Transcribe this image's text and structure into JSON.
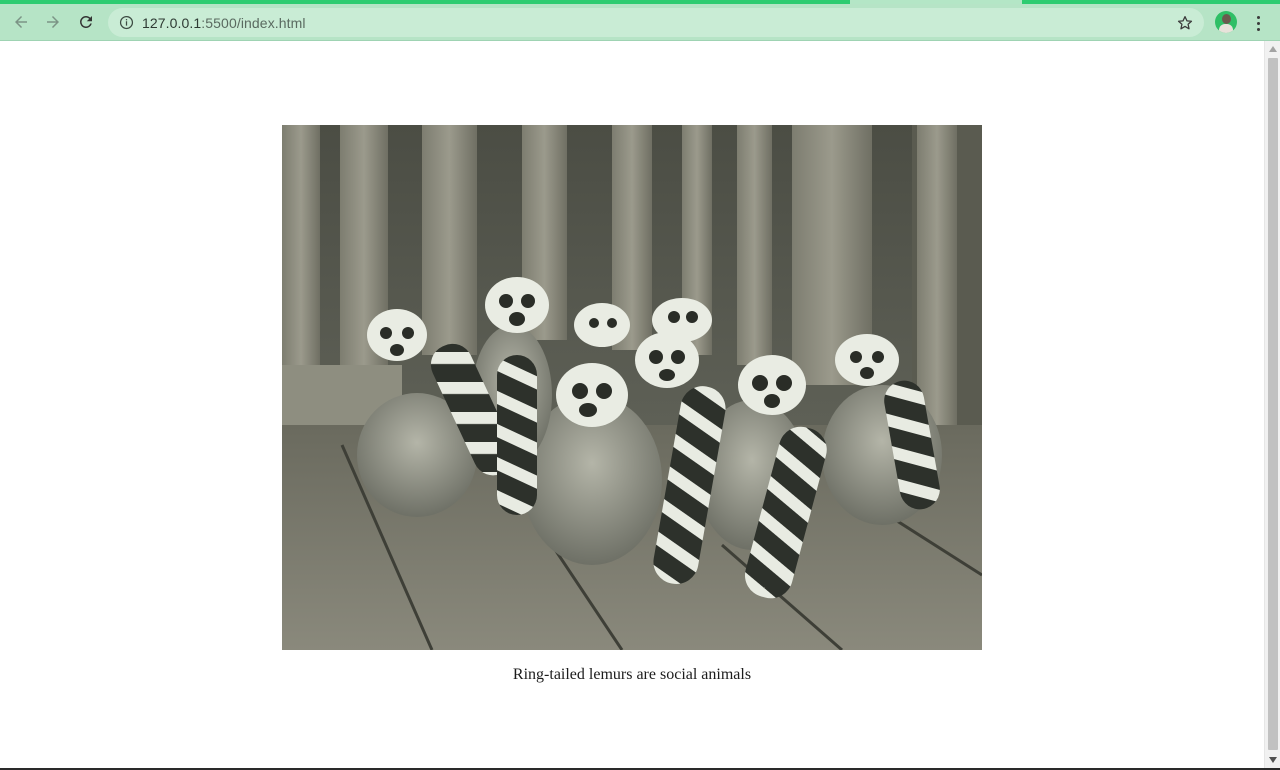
{
  "browser": {
    "url_host": "127.0.0.1",
    "url_rest": ":5500/index.html",
    "icons": {
      "back": "arrow-left-icon",
      "forward": "arrow-right-icon",
      "reload": "reload-icon",
      "site_info": "info-icon",
      "bookmark": "star-icon",
      "profile": "avatar",
      "menu": "kebab-menu-icon"
    },
    "theme_color": "#2ecc71"
  },
  "page": {
    "figure": {
      "image_subject": "ring-tailed-lemurs-photo",
      "caption": "Ring-tailed lemurs are social animals"
    }
  }
}
